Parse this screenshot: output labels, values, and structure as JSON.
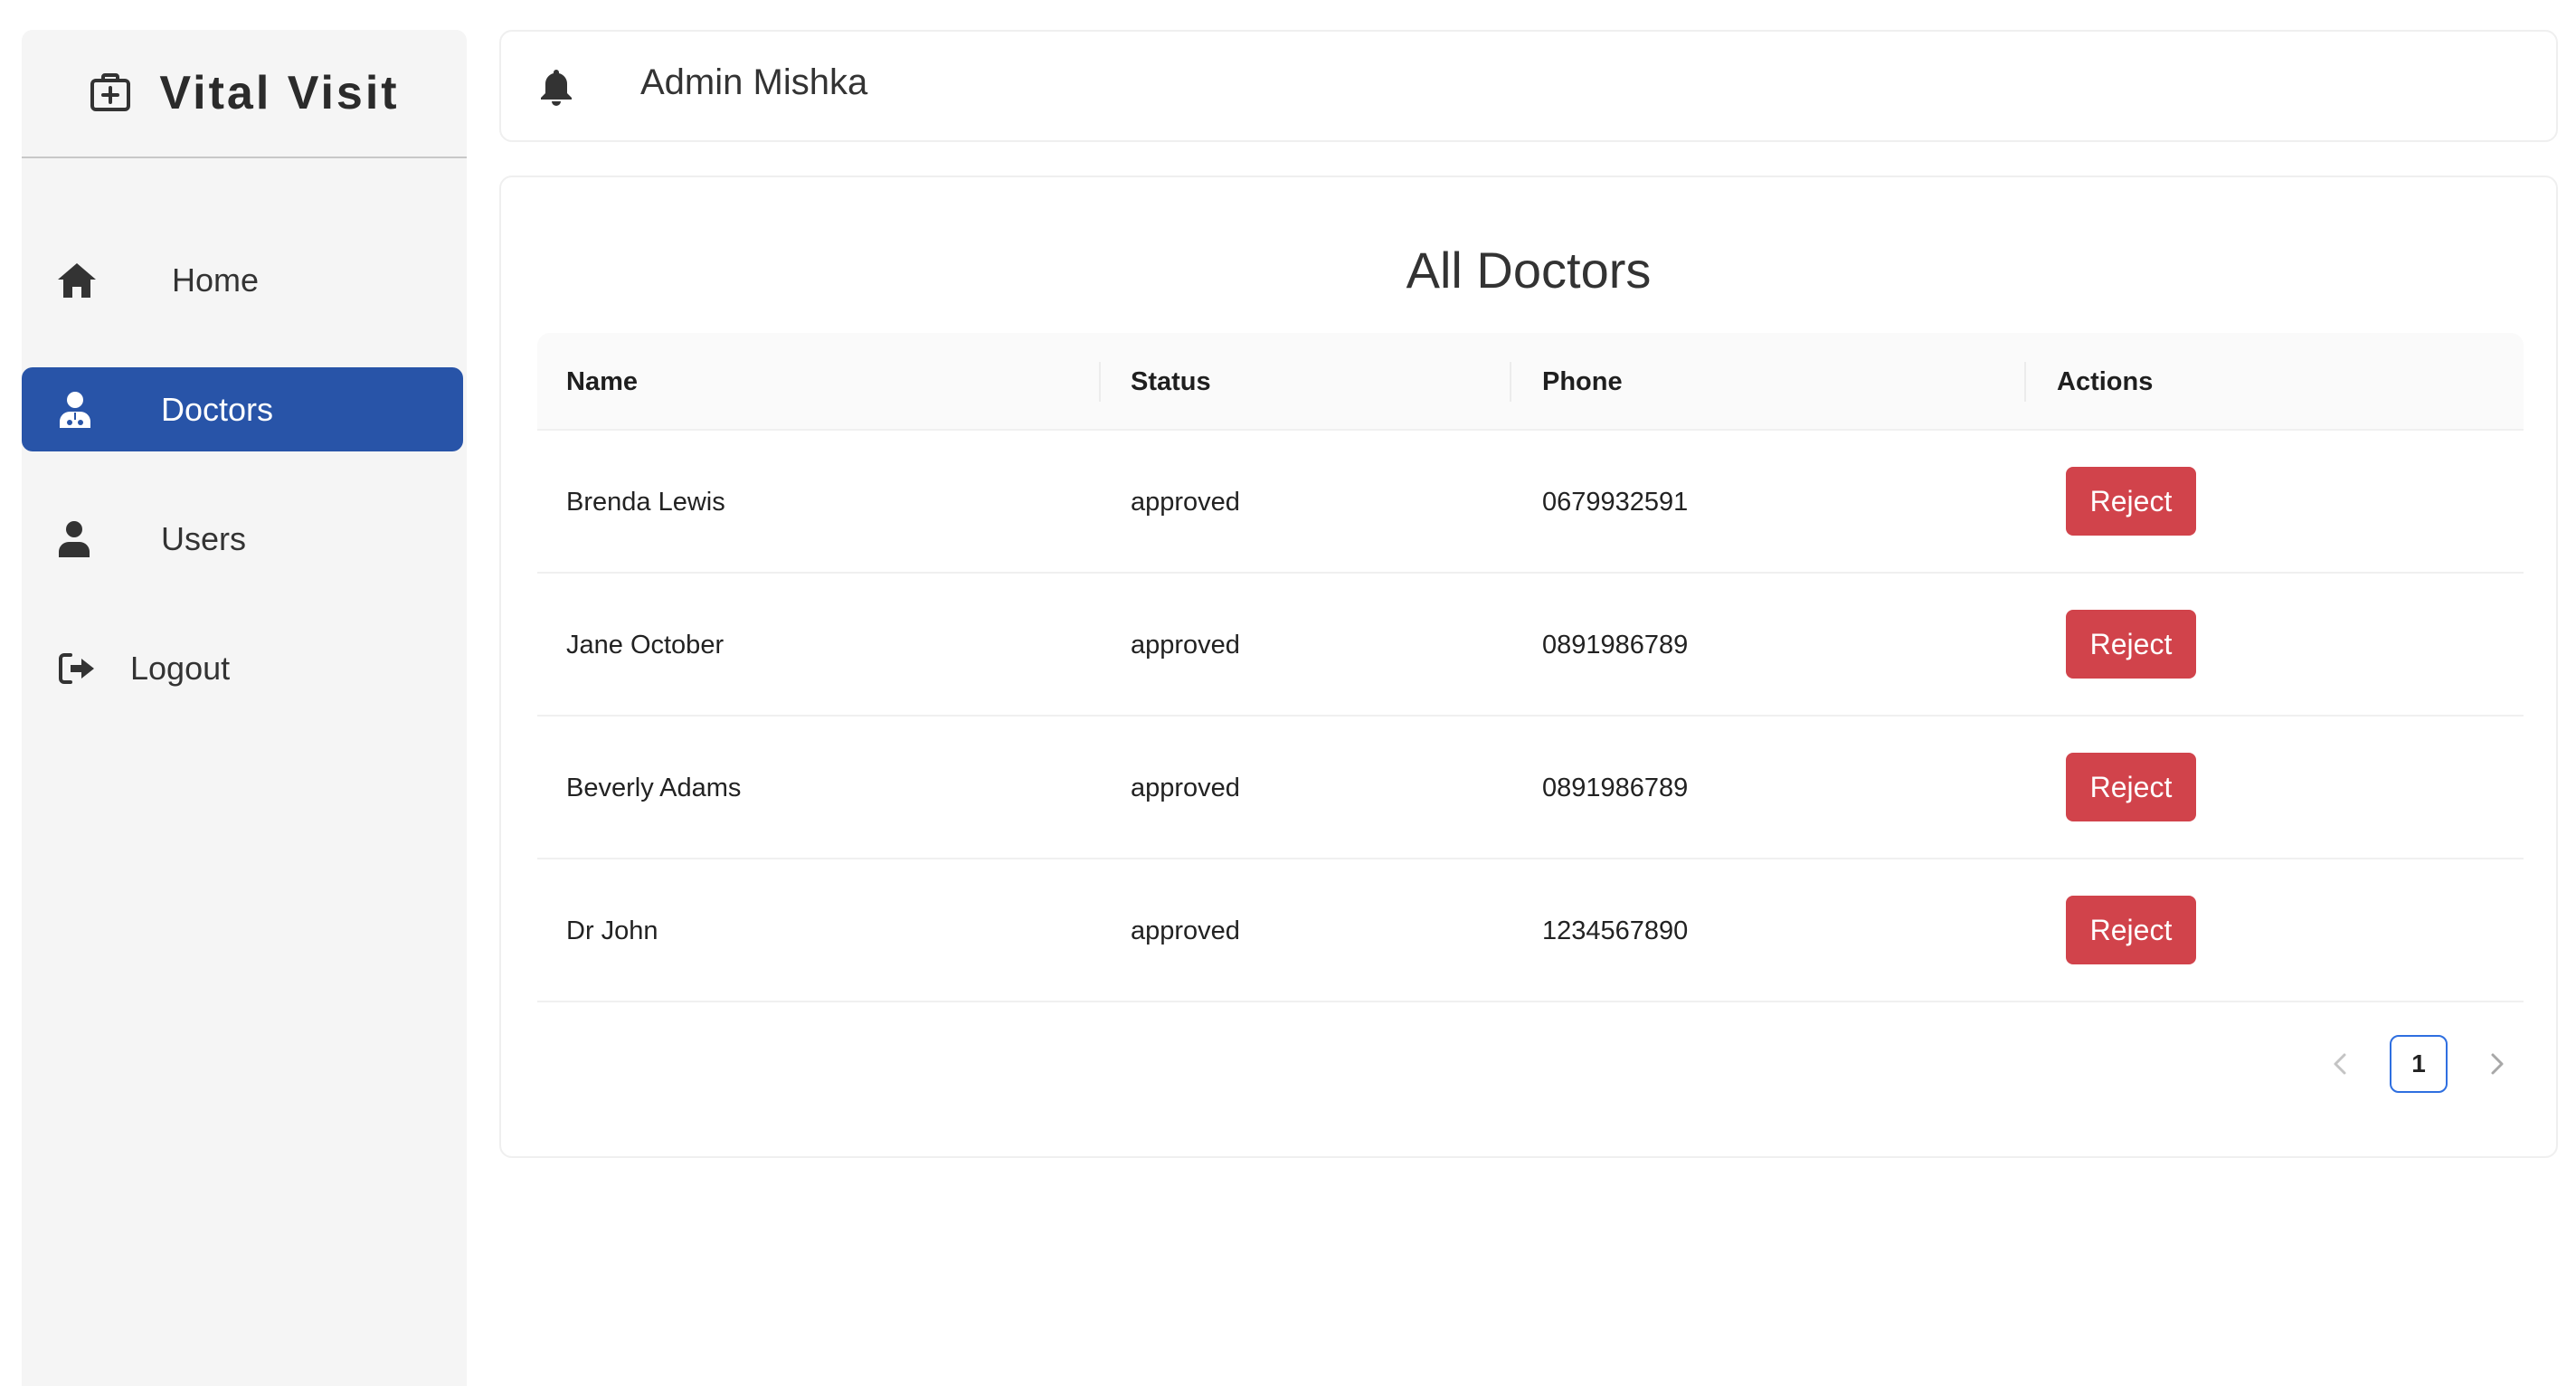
{
  "app": {
    "title": "Vital Visit",
    "icon": "medical-kit-icon"
  },
  "sidebar": {
    "items": [
      {
        "label": "Home",
        "icon": "home-icon",
        "active": false
      },
      {
        "label": "Doctors",
        "icon": "doctor-icon",
        "active": true
      },
      {
        "label": "Users",
        "icon": "user-icon",
        "active": false
      },
      {
        "label": "Logout",
        "icon": "logout-icon",
        "active": false
      }
    ],
    "active_color": "#2854a8"
  },
  "header": {
    "notification_icon": "bell-icon",
    "user_name": "Admin Mishka"
  },
  "main": {
    "title": "All Doctors",
    "table": {
      "columns": [
        "Name",
        "Status",
        "Phone",
        "Actions"
      ],
      "rows": [
        {
          "name": "Brenda Lewis",
          "status": "approved",
          "phone": "0679932591",
          "action": "Reject"
        },
        {
          "name": "Jane October",
          "status": "approved",
          "phone": "0891986789",
          "action": "Reject"
        },
        {
          "name": "Beverly Adams",
          "status": "approved",
          "phone": "0891986789",
          "action": "Reject"
        },
        {
          "name": "Dr John",
          "status": "approved",
          "phone": "1234567890",
          "action": "Reject"
        }
      ],
      "action_color": "#d1434b"
    },
    "pagination": {
      "current_page": "1",
      "prev_icon": "chevron-left-icon",
      "next_icon": "chevron-right-icon"
    }
  }
}
